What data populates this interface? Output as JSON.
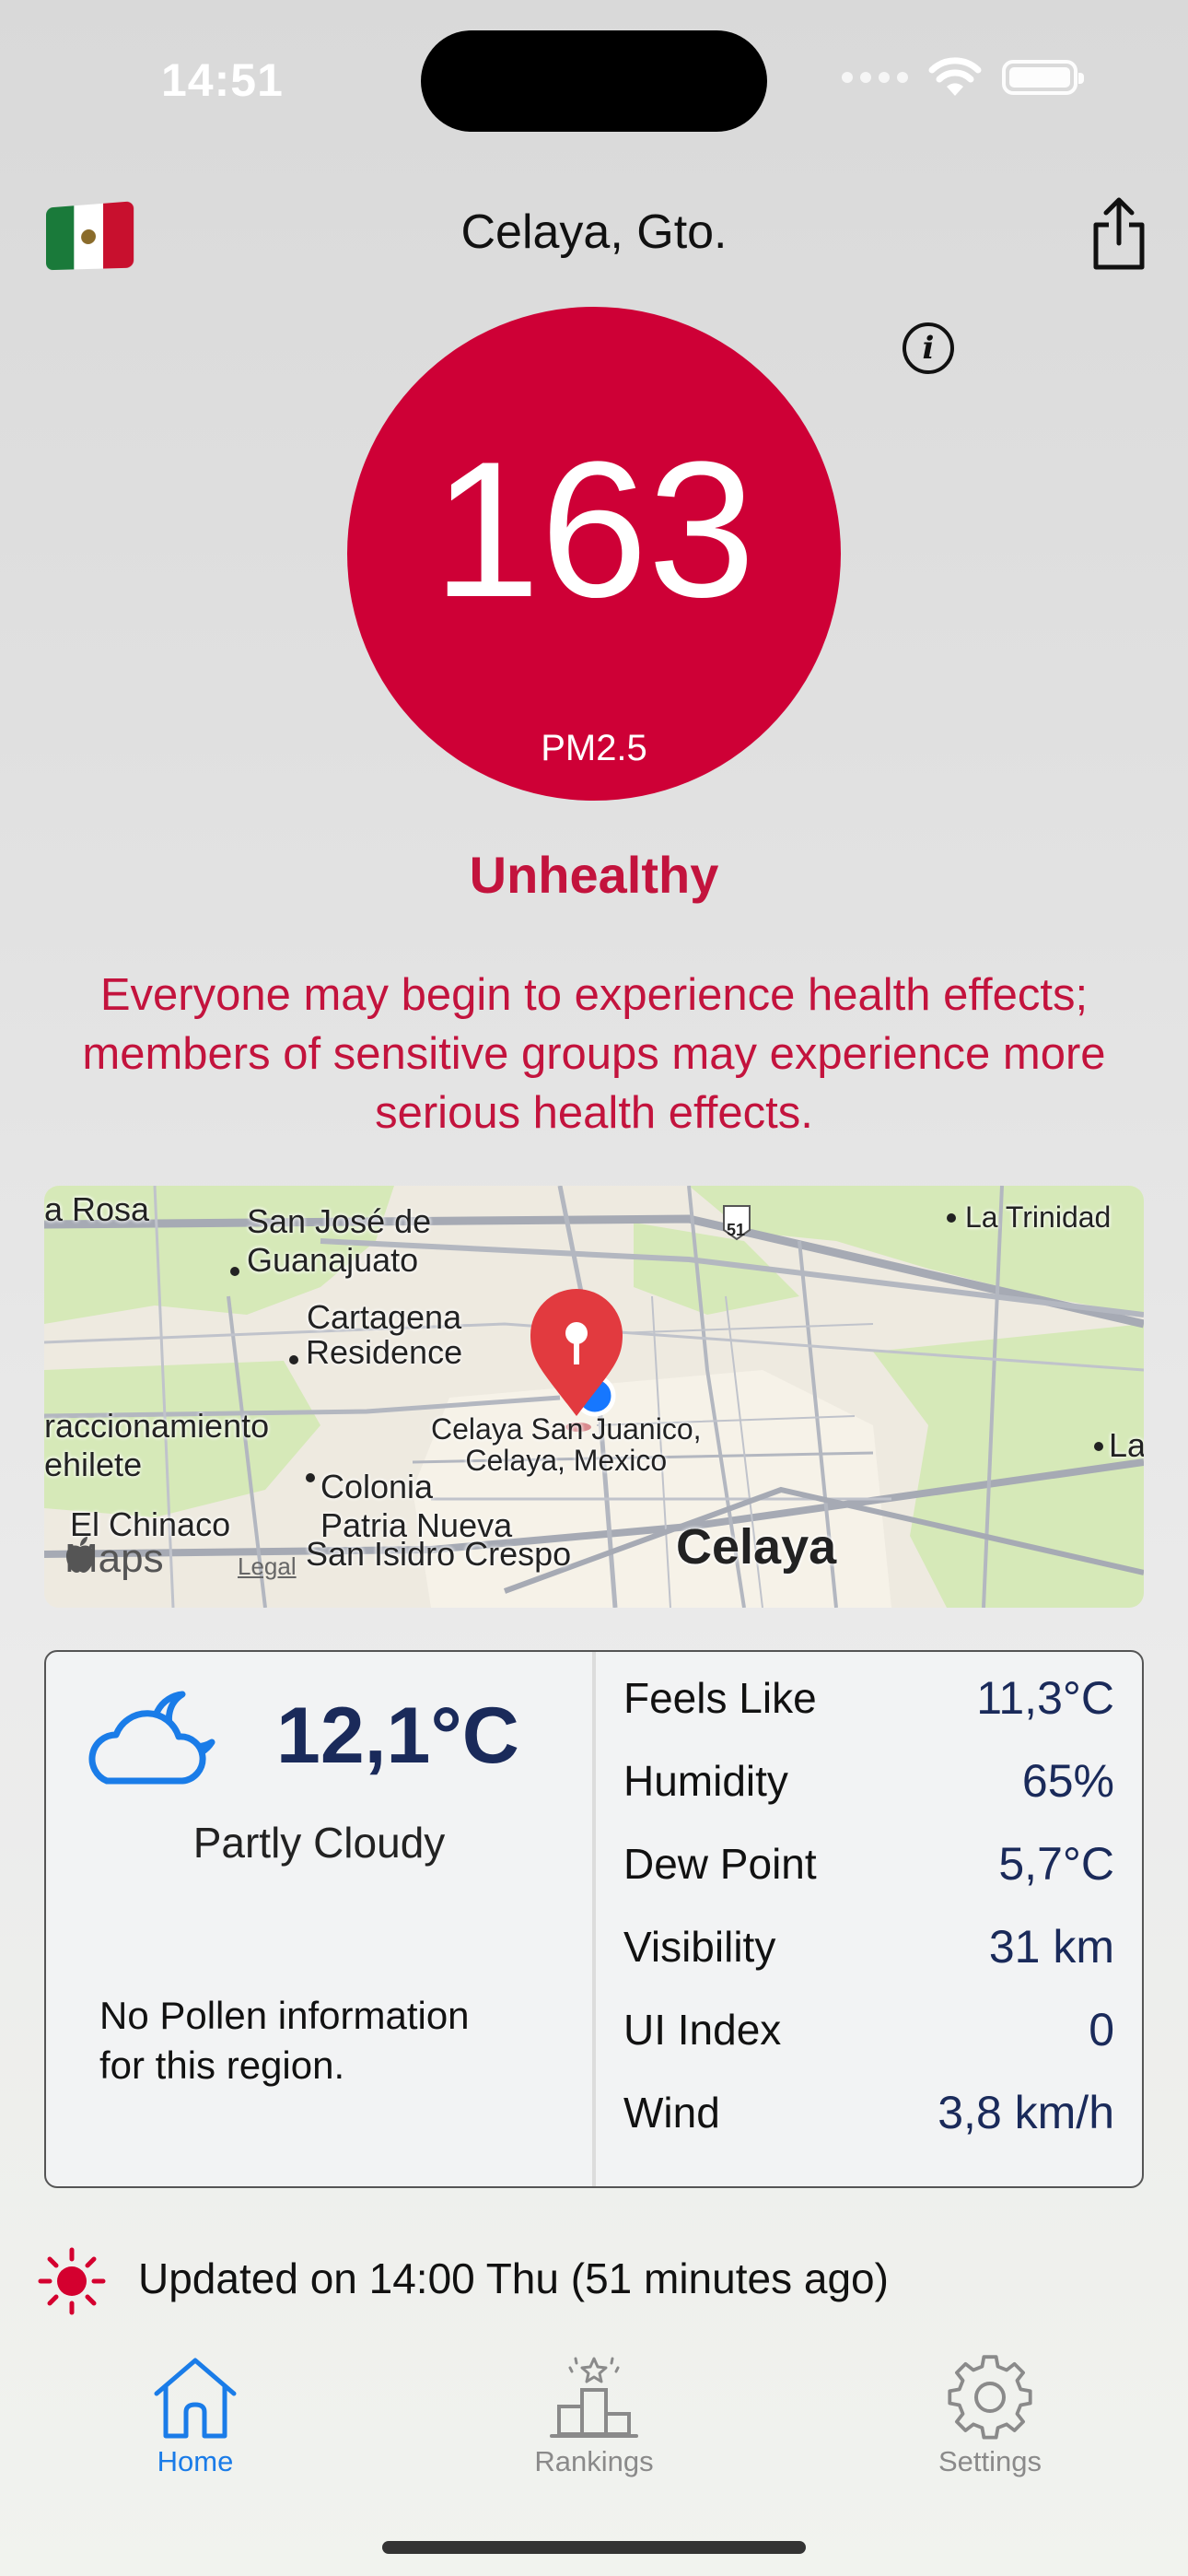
{
  "status_bar": {
    "time": "14:51",
    "icons": [
      "cellular-icon",
      "wifi-icon",
      "battery-icon"
    ]
  },
  "header": {
    "flag": "mexico-flag-icon",
    "city": "Celaya, Gto.",
    "share_icon": "share-icon"
  },
  "aqi": {
    "value": "163",
    "pollutant": "PM2.5",
    "level": "Unhealthy",
    "description": "Everyone may begin to experience health effects; members of sensitive groups may experience more serious health effects.",
    "color": "#ce0036",
    "text_color": "#c3133d"
  },
  "map": {
    "labels": {
      "la_rosa": "a Rosa",
      "san_jose": "San José de\nGuanajuato",
      "la_trinidad": "La Trinidad",
      "cartagena": "Cartagena\nResidence",
      "fraccionamiento": "raccionamiento\nehilete",
      "celaya_juanico": "Celaya San Juanico,\nCelaya, Mexico",
      "colonia": "Colonia\nPatria Nueva",
      "el_chinaco": "El Chinaco",
      "san_isidro": "San Isidro Crespo",
      "celaya": "Celaya",
      "la_right": "La",
      "highway": "51"
    },
    "attribution": "Maps",
    "legal": "Legal"
  },
  "weather": {
    "temperature": "12,1°C",
    "condition": "Partly Cloudy",
    "pollen": "No Pollen information\nfor this region.",
    "stats": [
      {
        "label": "Feels Like",
        "value": "11,3°C"
      },
      {
        "label": "Humidity",
        "value": "65%"
      },
      {
        "label": "Dew Point",
        "value": "5,7°C"
      },
      {
        "label": "Visibility",
        "value": "31 km"
      },
      {
        "label": "UI Index",
        "value": "0"
      },
      {
        "label": "Wind",
        "value": "3,8 km/h"
      }
    ]
  },
  "updated": {
    "text": "Updated on 14:00 Thu (51 minutes ago)",
    "icon_color": "#d4002f"
  },
  "tabs": [
    {
      "label": "Home",
      "icon": "home-icon",
      "active": true
    },
    {
      "label": "Rankings",
      "icon": "rankings-icon",
      "active": false
    },
    {
      "label": "Settings",
      "icon": "gear-icon",
      "active": false
    }
  ],
  "colors": {
    "accent": "#1a7ce8",
    "inactive_tab": "#8a8a8a",
    "stat_value": "#1a2a5a"
  }
}
